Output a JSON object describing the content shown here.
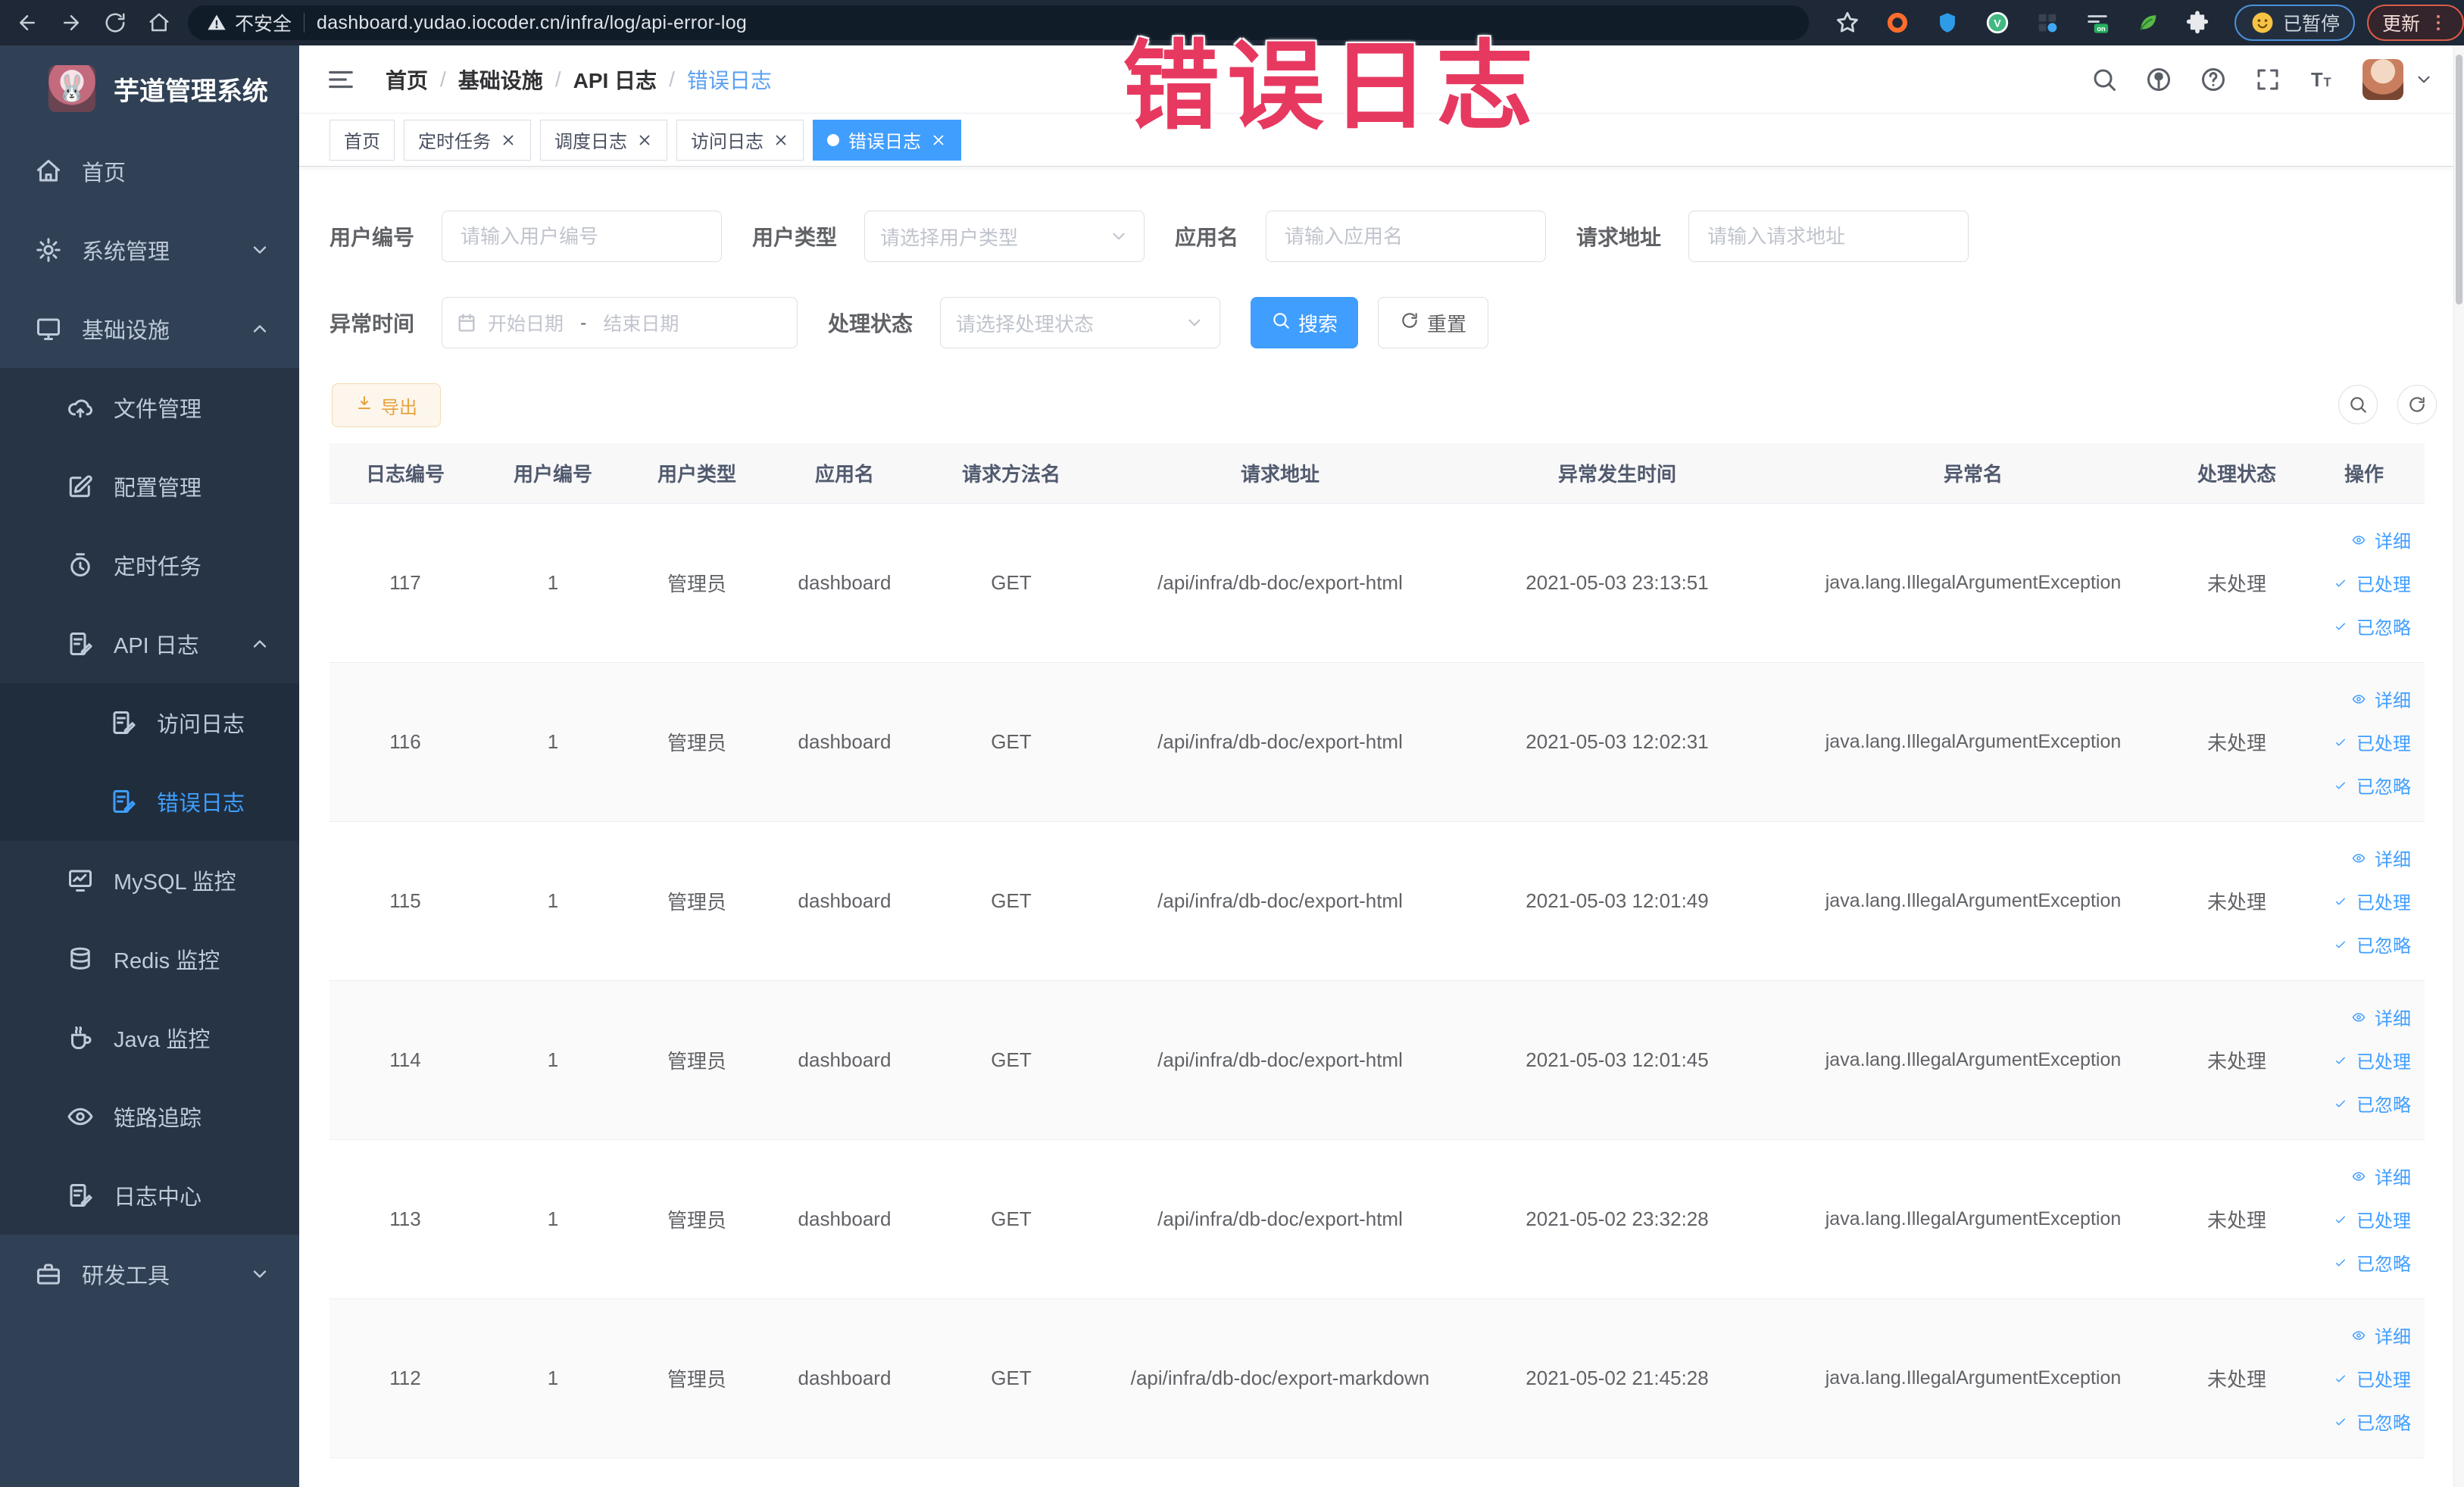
{
  "colors": {
    "primary": "#409eff",
    "warning_button_text": "#e6a23c",
    "annotation": "#e73960",
    "sidebar_bg": "#304156",
    "submenu_bg": "#263445",
    "browser_bar_bg": "#1e2836",
    "active_tab_bg": "#409eff"
  },
  "annotation_overlay": "错误日志",
  "browser": {
    "nav_icons": [
      "back-icon",
      "forward-icon",
      "reload-icon",
      "home-icon"
    ],
    "security_label": "不安全",
    "url": "dashboard.yudao.iocoder.cn/infra/log/api-error-log",
    "extension_icons": [
      "bookmark-star-icon",
      "orange-ring-extension-icon",
      "blue-shield-extension-icon",
      "vue-devtools-icon",
      "grid-extension-icon",
      "switch-on-extension-icon",
      "leaf-extension-icon",
      "extensions-puzzle-icon"
    ],
    "paused_chip_label": "已暂停",
    "update_chip_label": "更新"
  },
  "sidebar": {
    "logo_title": "芋道管理系统",
    "items": [
      {
        "label": "首页",
        "icon": "home-menu-icon",
        "level": 1
      },
      {
        "label": "系统管理",
        "icon": "gear-icon",
        "level": 1,
        "chevron": "down"
      },
      {
        "label": "基础设施",
        "icon": "monitor-icon",
        "level": 1,
        "chevron": "up"
      },
      {
        "label": "文件管理",
        "icon": "cloud-upload-icon",
        "level": 2
      },
      {
        "label": "配置管理",
        "icon": "edit-icon",
        "level": 2
      },
      {
        "label": "定时任务",
        "icon": "timer-icon",
        "level": 2
      },
      {
        "label": "API 日志",
        "icon": "log-icon",
        "level": 2,
        "chevron": "up"
      },
      {
        "label": "访问日志",
        "icon": "log-icon",
        "level": 3
      },
      {
        "label": "错误日志",
        "icon": "log-icon",
        "level": 3,
        "active": true
      },
      {
        "label": "MySQL 监控",
        "icon": "chart-monitor-icon",
        "level": 2
      },
      {
        "label": "Redis 监控",
        "icon": "database-icon",
        "level": 2
      },
      {
        "label": "Java 监控",
        "icon": "java-icon",
        "level": 2
      },
      {
        "label": "链路追踪",
        "icon": "eye-icon",
        "level": 2
      },
      {
        "label": "日志中心",
        "icon": "log-icon",
        "level": 2
      },
      {
        "label": "研发工具",
        "icon": "toolbox-icon",
        "level": 1,
        "chevron": "down"
      }
    ]
  },
  "header": {
    "breadcrumb": [
      "首页",
      "基础设施",
      "API 日志",
      "错误日志"
    ],
    "right_icons": [
      "search-icon",
      "github-icon",
      "help-icon",
      "fullscreen-icon",
      "font-size-icon"
    ]
  },
  "tags_view": {
    "tabs": [
      {
        "label": "首页",
        "active": false,
        "closable": false
      },
      {
        "label": "定时任务",
        "active": false,
        "closable": true
      },
      {
        "label": "调度日志",
        "active": false,
        "closable": true
      },
      {
        "label": "访问日志",
        "active": false,
        "closable": true
      },
      {
        "label": "错误日志",
        "active": true,
        "closable": true
      }
    ]
  },
  "filters": {
    "user_id_label": "用户编号",
    "user_id_placeholder": "请输入用户编号",
    "user_type_label": "用户类型",
    "user_type_placeholder": "请选择用户类型",
    "app_name_label": "应用名",
    "app_name_placeholder": "请输入应用名",
    "request_url_label": "请求地址",
    "request_url_placeholder": "请输入请求地址",
    "exception_time_label": "异常时间",
    "date_start_placeholder": "开始日期",
    "date_separator": "-",
    "date_end_placeholder": "结束日期",
    "process_status_label": "处理状态",
    "process_status_placeholder": "请选择处理状态",
    "search_label": "搜索",
    "reset_label": "重置"
  },
  "toolbar": {
    "export_label": "导出"
  },
  "table": {
    "columns": [
      "日志编号",
      "用户编号",
      "用户类型",
      "应用名",
      "请求方法名",
      "请求地址",
      "异常发生时间",
      "异常名",
      "处理状态",
      "操作"
    ],
    "row_actions": [
      {
        "icon": "eye-icon",
        "label": "详细"
      },
      {
        "icon": "check-icon",
        "label": "已处理"
      },
      {
        "icon": "check-icon",
        "label": "已忽略"
      }
    ],
    "rows": [
      {
        "log_id": "117",
        "user_id": "1",
        "user_type": "管理员",
        "app": "dashboard",
        "method": "GET",
        "url": "/api/infra/db-doc/export-html",
        "time": "2021-05-03 23:13:51",
        "exception": "java.lang.IllegalArgumentException",
        "status": "未处理"
      },
      {
        "log_id": "116",
        "user_id": "1",
        "user_type": "管理员",
        "app": "dashboard",
        "method": "GET",
        "url": "/api/infra/db-doc/export-html",
        "time": "2021-05-03 12:02:31",
        "exception": "java.lang.IllegalArgumentException",
        "status": "未处理"
      },
      {
        "log_id": "115",
        "user_id": "1",
        "user_type": "管理员",
        "app": "dashboard",
        "method": "GET",
        "url": "/api/infra/db-doc/export-html",
        "time": "2021-05-03 12:01:49",
        "exception": "java.lang.IllegalArgumentException",
        "status": "未处理"
      },
      {
        "log_id": "114",
        "user_id": "1",
        "user_type": "管理员",
        "app": "dashboard",
        "method": "GET",
        "url": "/api/infra/db-doc/export-html",
        "time": "2021-05-03 12:01:45",
        "exception": "java.lang.IllegalArgumentException",
        "status": "未处理"
      },
      {
        "log_id": "113",
        "user_id": "1",
        "user_type": "管理员",
        "app": "dashboard",
        "method": "GET",
        "url": "/api/infra/db-doc/export-html",
        "time": "2021-05-02 23:32:28",
        "exception": "java.lang.IllegalArgumentException",
        "status": "未处理"
      },
      {
        "log_id": "112",
        "user_id": "1",
        "user_type": "管理员",
        "app": "dashboard",
        "method": "GET",
        "url": "/api/infra/db-doc/export-markdown",
        "time": "2021-05-02 21:45:28",
        "exception": "java.lang.IllegalArgumentException",
        "status": "未处理"
      }
    ]
  }
}
